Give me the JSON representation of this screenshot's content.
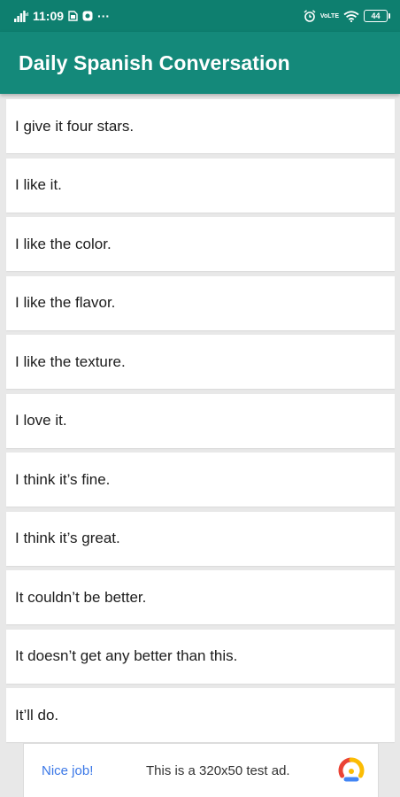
{
  "status_bar": {
    "time": "11:09",
    "battery": "44",
    "left_icons": [
      "signal-icon",
      "sim-icon",
      "notification-icon",
      "more-dots-icon"
    ],
    "right_icons": [
      "alarm-icon",
      "volte-icon",
      "wifi-icon",
      "battery-icon"
    ],
    "volte_top": "Vo",
    "volte_bottom": "LTE",
    "more": "···"
  },
  "app_bar": {
    "title": "Daily Spanish Conversation",
    "color": "#14897a"
  },
  "phrases": [
    "I give it four stars.",
    "I like it.",
    "I like the color.",
    "I like the flavor.",
    "I like the texture.",
    "I love it.",
    "I think it’s fine.",
    "I think it’s great.",
    "It couldn’t be better.",
    "It doesn’t get any better than this.",
    "It’ll do."
  ],
  "ad": {
    "cta": "Nice job!",
    "text": "This is a 320x50 test ad.",
    "logo_icon": "adchoices-logo-icon"
  }
}
